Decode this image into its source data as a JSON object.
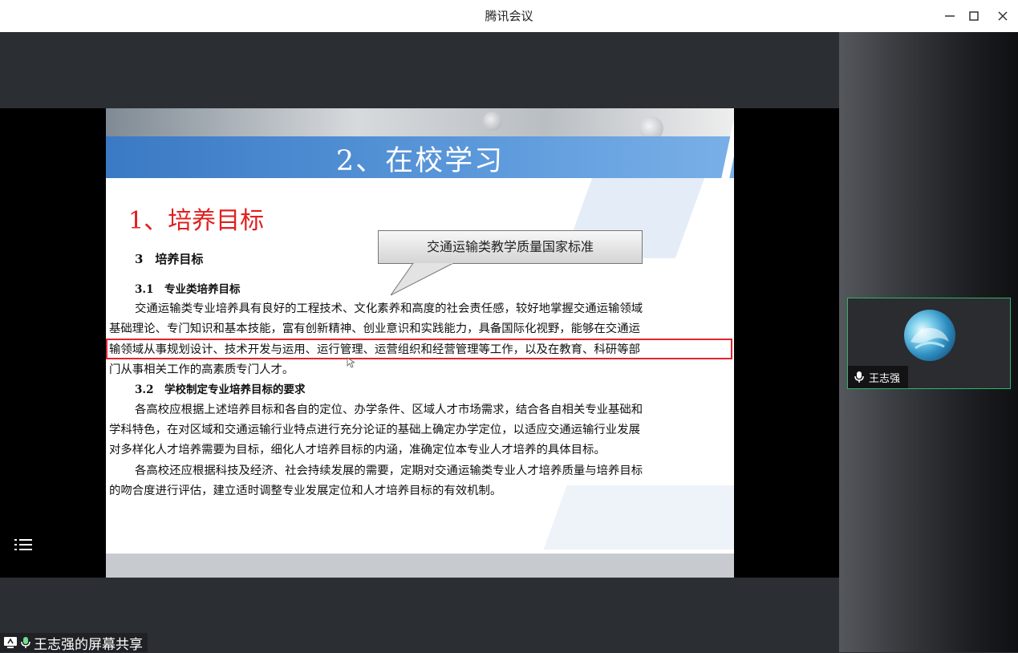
{
  "app": {
    "title": "腾讯会议"
  },
  "window_controls": {
    "minimize_icon": "minimize-icon",
    "maximize_icon": "maximize-icon",
    "close_icon": "close-icon"
  },
  "slide": {
    "title": "2、在校学习",
    "heading": "1、培养目标",
    "callout": "交通运输类教学质量国家标准",
    "section": "3　培养目标",
    "subsection_1": "3.1　专业类培养目标",
    "para1_line1": "交通运输类专业培养具有良好的工程技术、文化素养和高度的社会责任感，较好地掌握交通运输领域",
    "para1_line2": "基础理论、专门知识和基本技能，富有创新精神、创业意识和实践能力，具备国际化视野，能够在交通运",
    "para1_line3": "输领域从事规划设计、技术开发与运用、运行管理、运营组织和经营管理等工作，以及在教育、科研等部",
    "para1_line4": "门从事相关工作的高素质专门人才。",
    "subsection_2": "3.2　学校制定专业培养目标的要求",
    "para2_line1": "各高校应根据上述培养目标和各自的定位、办学条件、区域人才市场需求，结合各自相关专业基础和",
    "para2_line2": "学科特色，在对区域和交通运输行业特点进行充分论证的基础上确定办学定位，以适应交通运输行业发展",
    "para2_line3": "对多样化人才培养需要为目标，细化人才培养目标的内涵，准确定位本专业人才培养的具体目标。",
    "para3_line1": "各高校还应根据科技及经济、社会持续发展的需要，定期对交通运输类专业人才培养质量与培养目标",
    "para3_line2": "的吻合度进行评估，建立适时调整专业发展定位和人才培养目标的有效机制。"
  },
  "participant": {
    "name": "王志强",
    "mic_icon": "microphone-icon"
  },
  "share": {
    "label": "王志强的屏幕共享",
    "screen_icon": "screen-share-icon",
    "mic_icon": "microphone-icon"
  },
  "menu": {
    "icon": "list-menu-icon"
  },
  "colors": {
    "accent": "#2fb56a",
    "highlight": "#e0262e",
    "slide_heading": "#e02020",
    "title_band": "#3a79c4"
  }
}
